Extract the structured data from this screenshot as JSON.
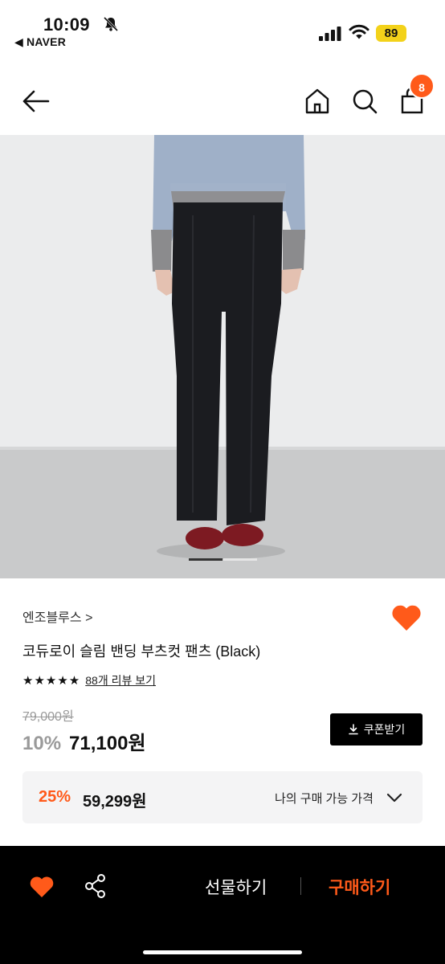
{
  "status_bar": {
    "time": "10:09",
    "back_app": "◀ NAVER",
    "battery": "89",
    "icons": [
      "bell-muted-icon",
      "signal-icon",
      "wifi-icon",
      "battery-icon"
    ]
  },
  "header": {
    "icons": [
      "back-arrow-icon",
      "home-icon",
      "search-icon",
      "shopping-bag-icon"
    ],
    "cart_count": "8"
  },
  "product": {
    "brand": "엔조블루스",
    "brand_arrow": ">",
    "title": "코듀로이 슬림 밴딩 부츠컷 팬츠 (Black)",
    "stars": "★★★★★",
    "review_link": "88개 리뷰 보기",
    "original_price": "79,000원",
    "discount_rate": "10%",
    "sale_price": "71,100원",
    "coupon_label": "쿠폰받기",
    "image_page": 1,
    "image_count": 2
  },
  "benefit": {
    "rate": "25%",
    "price": "59,299원",
    "label": "나의 구매 가능 가격"
  },
  "bottom_bar": {
    "gift_label": "선물하기",
    "buy_label": "구매하기"
  },
  "colors": {
    "accent": "#ff5a1a",
    "coupon_bg": "#000000",
    "battery": "#f3d21a"
  }
}
